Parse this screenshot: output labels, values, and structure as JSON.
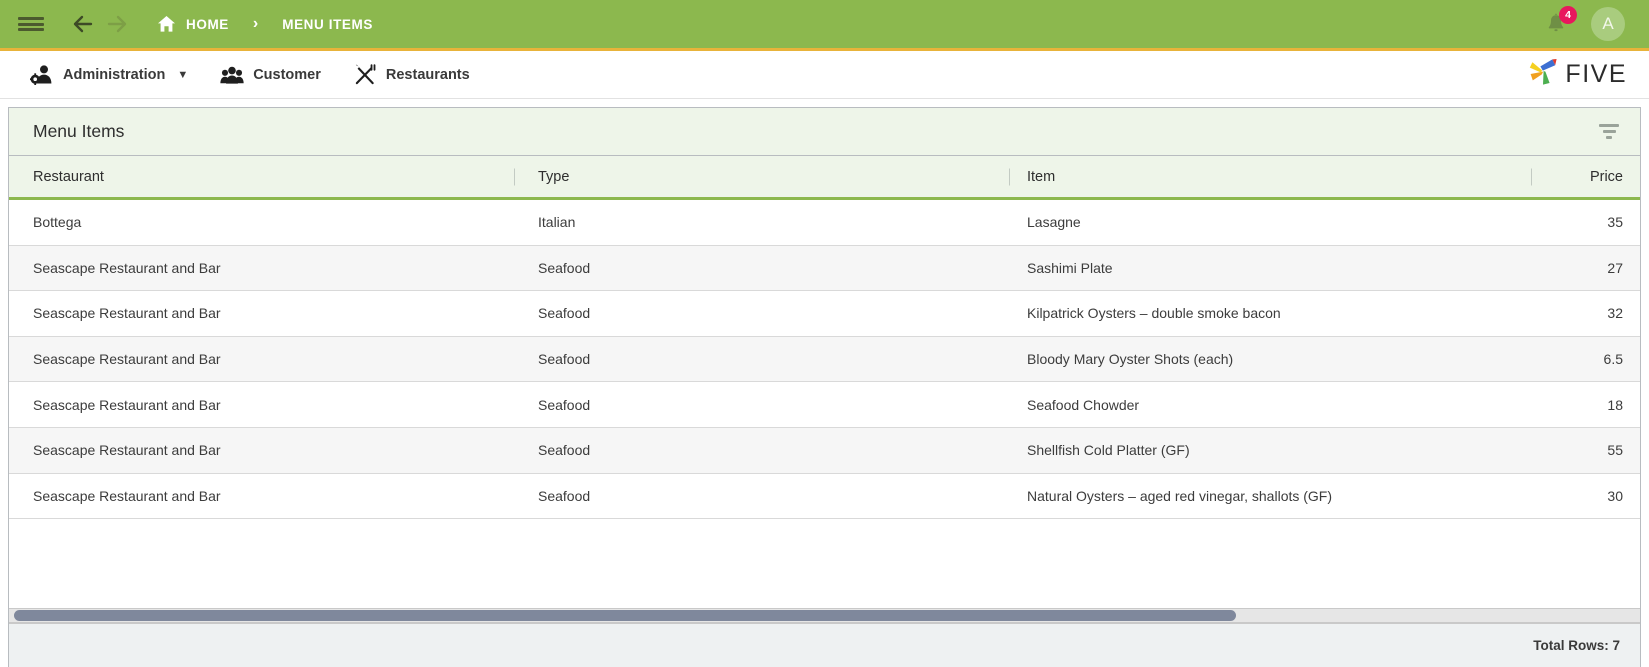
{
  "topbar": {
    "menu_icon": "hamburger-icon",
    "back_icon": "arrow-left-icon",
    "forward_icon": "arrow-right-icon",
    "home_icon": "home-icon",
    "home_label": "HOME",
    "separator": "›",
    "current_label": "MENU ITEMS",
    "notification_icon": "bell-icon",
    "notification_count": "4",
    "avatar_initial": "A",
    "bg_color": "#8cb84e",
    "accent_underline": "#e8b33a",
    "badge_color": "#e8175d"
  },
  "subnav": {
    "items": [
      {
        "label": "Administration",
        "icon": "admin-user-gear-icon",
        "caret": "▼"
      },
      {
        "label": "Customer",
        "icon": "people-group-icon",
        "caret": ""
      },
      {
        "label": "Restaurants",
        "icon": "fork-knife-icon",
        "caret": ""
      }
    ],
    "brand_text": "FIVE",
    "brand_icon": "five-pinwheel-logo",
    "brand_colors": [
      "#3d6fd1",
      "#e03b2f",
      "#f0a020",
      "#f5d020",
      "#4caf50"
    ]
  },
  "panel": {
    "title": "Menu Items",
    "filter_icon": "filter-icon",
    "header_bg": "#eef5e9",
    "header_accent": "#8cb84e"
  },
  "grid": {
    "columns": [
      {
        "key": "restaurant",
        "label": "Restaurant",
        "align": "left"
      },
      {
        "key": "type",
        "label": "Type",
        "align": "left"
      },
      {
        "key": "item",
        "label": "Item",
        "align": "left"
      },
      {
        "key": "price",
        "label": "Price",
        "align": "right"
      }
    ],
    "rows": [
      {
        "restaurant": "Bottega",
        "type": "Italian",
        "item": "Lasagne",
        "price": "35"
      },
      {
        "restaurant": "Seascape Restaurant and Bar",
        "type": "Seafood",
        "item": "Sashimi Plate",
        "price": "27"
      },
      {
        "restaurant": "Seascape Restaurant and Bar",
        "type": "Seafood",
        "item": "Kilpatrick Oysters – double smoke bacon",
        "price": "32"
      },
      {
        "restaurant": "Seascape Restaurant and Bar",
        "type": "Seafood",
        "item": "Bloody Mary Oyster Shots (each)",
        "price": "6.5"
      },
      {
        "restaurant": "Seascape Restaurant and Bar",
        "type": "Seafood",
        "item": "Seafood Chowder",
        "price": "18"
      },
      {
        "restaurant": "Seascape Restaurant and Bar",
        "type": "Seafood",
        "item": "Shellfish Cold Platter (GF)",
        "price": "55"
      },
      {
        "restaurant": "Seascape Restaurant and Bar",
        "type": "Seafood",
        "item": "Natural Oysters – aged red vinegar, shallots (GF)",
        "price": "30"
      }
    ],
    "footer_total": "Total Rows: 7",
    "scrollbar_orientation": "horizontal"
  }
}
